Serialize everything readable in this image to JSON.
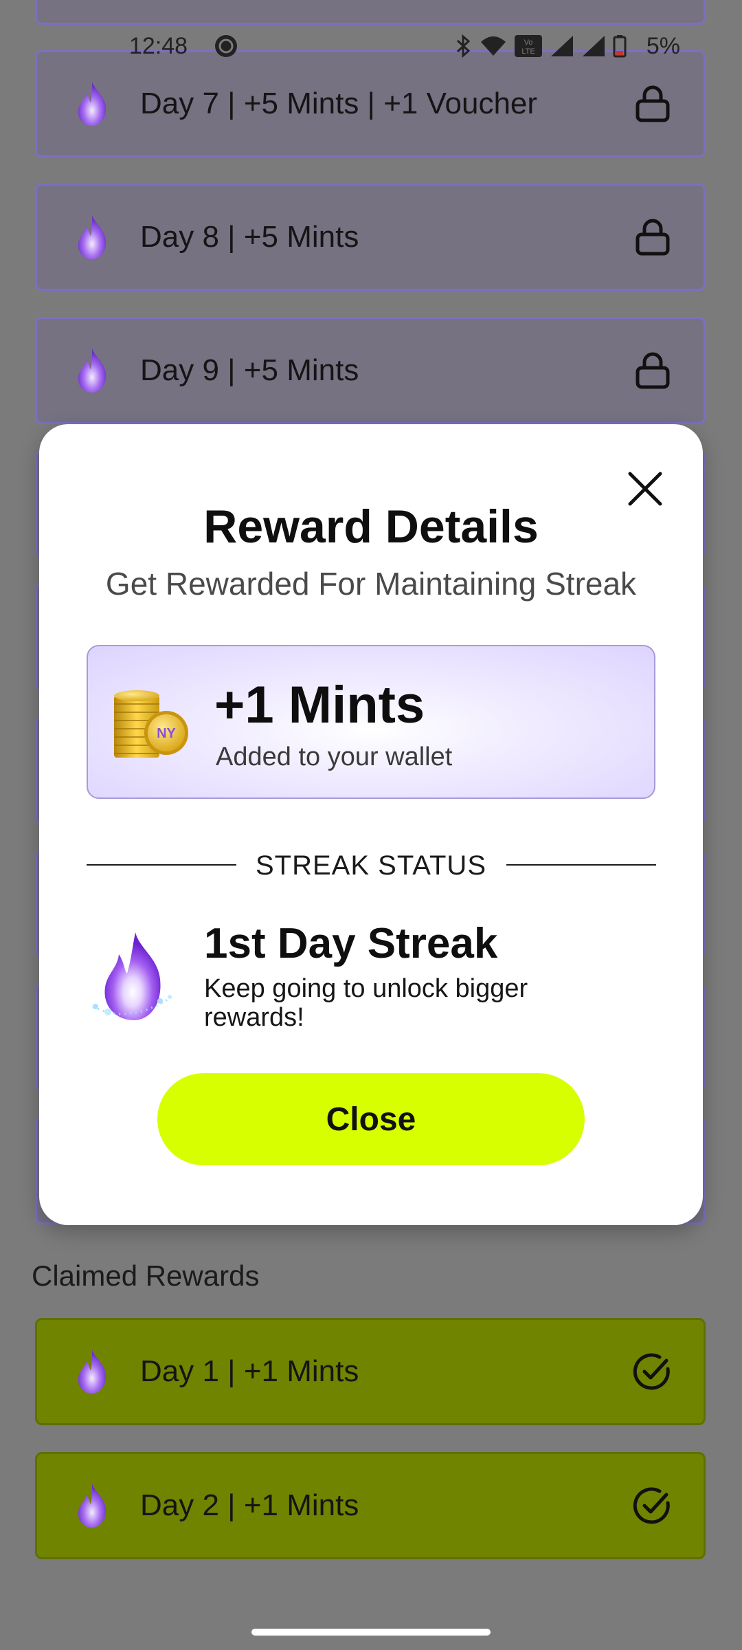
{
  "status_bar": {
    "time": "12:48",
    "battery_percent": "5%",
    "icons": [
      "whatsapp-icon",
      "bluetooth-icon",
      "wifi-icon",
      "volte-icon",
      "signal-icon",
      "signal-icon",
      "battery-icon"
    ]
  },
  "background_list": {
    "locked_items": [
      {
        "label": "Day 7 | +5 Mints | +1 Voucher",
        "icon": "lock-icon"
      },
      {
        "label": "Day 8 | +5 Mints",
        "icon": "lock-icon"
      },
      {
        "label": "Day 9 | +5 Mints",
        "icon": "lock-icon"
      }
    ],
    "claimed_title": "Claimed Rewards",
    "claimed_items": [
      {
        "label": "Day 1 | +1 Mints",
        "icon": "check-circle-icon"
      },
      {
        "label": "Day 2 | +1 Mints",
        "icon": "check-circle-icon"
      }
    ]
  },
  "modal": {
    "title": "Reward Details",
    "subtitle": "Get Rewarded For Maintaining Streak",
    "reward": {
      "amount": "+1 Mints",
      "caption": "Added to your wallet",
      "coin_badge": "NY"
    },
    "section_label": "STREAK STATUS",
    "streak": {
      "title": "1st Day Streak",
      "description": "Keep going to unlock bigger rewards!"
    },
    "close_label": "Close"
  },
  "colors": {
    "accent_button": "#d7ff00",
    "locked_border": "#7c6fc3",
    "claimed_bg": "#718400",
    "overlay": "#7b7b7b"
  }
}
